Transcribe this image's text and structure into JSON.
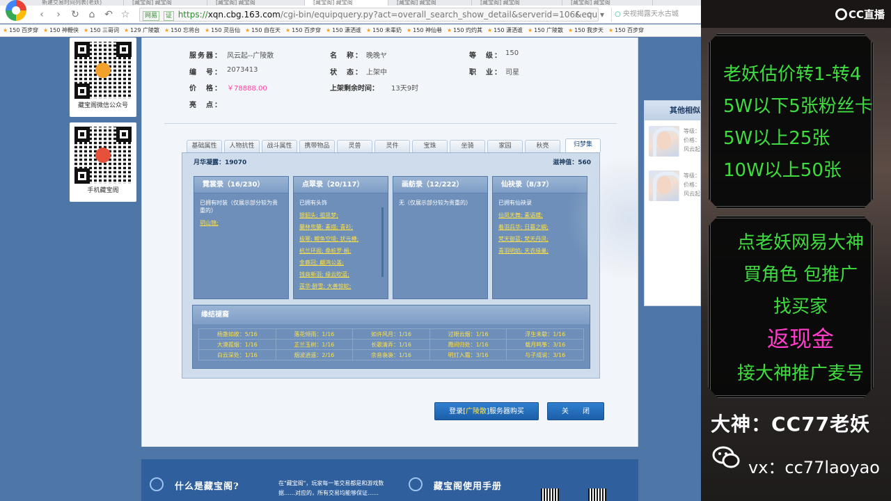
{
  "browser": {
    "tabs": [
      {
        "label": "新建交易时间列表(老妖)"
      },
      {
        "label": "[藏宝阁] 藏宝阁"
      },
      {
        "label": "[藏宝阁] 藏宝阁"
      },
      {
        "label": "[藏宝阁] 藏宝阁"
      },
      {
        "label": "[藏宝阁] 藏宝阁"
      },
      {
        "label": "[藏宝阁] 藏宝阁"
      },
      {
        "label": "[藏宝阁] 藏宝阁"
      }
    ],
    "addr_badge1": "网易",
    "addr_badge2": "证",
    "url_scheme": "https://",
    "url_host": "xqn.cbg.163.com",
    "url_path": "/cgi-bin/equipquery.py?act=overall_search_show_detail&serverid=106&equip_id=",
    "search_placeholder": "央视揭露天水古城",
    "bookmarks": [
      "150 百步穿",
      "150 神鞭侠",
      "150 三哥词",
      "129 广陵散",
      "150 忘将台",
      "150 灵岳仙",
      "150 自在天",
      "150 百步穿",
      "150 潇洒谁",
      "150 未辈奶",
      "150 神仙巷",
      "150 灼灼其",
      "150 潇洒谁",
      "150 广陵散",
      "150 我步天",
      "150 百步穿"
    ]
  },
  "left": {
    "qr1_label": "藏宝阁微信公众号",
    "qr2_label": "手机藏宝阁"
  },
  "info": {
    "server_key": "服务器：",
    "server_val": "风云起--广陵散",
    "name_key": "名　称：",
    "name_val": "晚晚ヤ",
    "level_key": "等　级：",
    "level_val": "150",
    "id_key": "编　号：",
    "id_val": "2073413",
    "status_key": "状　态：",
    "status_val": "上架中",
    "job_key": "职　业：",
    "job_val": "司星",
    "price_key": "价　格：",
    "price_val": "￥78888.00",
    "remain_key": "上架剩余时间：",
    "remain_val": "13天9时",
    "highlight_key": "亮　点："
  },
  "tabs": [
    "基础属性",
    "人物抗性",
    "战斗属性",
    "携带物品",
    "灵兽",
    "灵件",
    "宝珠",
    "坐骑",
    "家园",
    "秋亮",
    "归梦集"
  ],
  "summary": {
    "left": "月华凝露：19070",
    "right": "滋神值：560"
  },
  "cards": [
    {
      "title": "霓裳录（16/230）",
      "desc": "已拥有时装（仅展示部分较为贵重的）",
      "items": [
        "玥山锦;"
      ]
    },
    {
      "title": "点翠录（20/117）",
      "desc": "已拥有头饰",
      "items": [
        "银貂头;  祖思梦;",
        "蘭林兜蘭;  素描;  青衫;",
        "极寒;  鲤鱼空境;  状元樽;",
        "杭兰环阁;  桑桩罗·楫;",
        "金鹿冠;  翩鸿公盖;",
        "钱商新羽;  缘云吹蓝;",
        "莲华·醉雪;  大善惊蛇;"
      ]
    },
    {
      "title": "画舫录（12/222）",
      "desc": "无（仅展示部分较为贵重的）",
      "items": []
    },
    {
      "title": "仙袂录（8/37）",
      "desc": "已拥有仙袂录",
      "items": [
        "仙凤天舞;  素语蝶;",
        "着羽兵华;  日暮之嶼;",
        "梵天御蓝;  梵天丹凤;",
        "青羽明焰;  天衣缘巢;"
      ]
    }
  ],
  "bond": {
    "title": "缘结褪裔",
    "rows": [
      [
        "杨盏如故：5/16",
        "落花倾雨：1/16",
        "如许风月：1/16",
        "过眼云烟：1/16",
        "浮生未歇：1/16"
      ],
      [
        "大漠孤烟：1/16",
        "芷兰玉树：1/16",
        "长歌清弄：1/16",
        "霞间归处：1/16",
        "载月鸣筝：3/16"
      ],
      [
        "白云深处：1/16",
        "烟波逍遥：2/16",
        "余音袅袅：1/16",
        "明灯入霜：3/16",
        "与子成说：3/16"
      ]
    ]
  },
  "buttons": {
    "buy_prefix": "登录[",
    "buy_server": "广陵散",
    "buy_suffix": "]服务器购买",
    "close": "关　　闭"
  },
  "side": {
    "title": "其他相似",
    "items": [
      {
        "l1": "等级：",
        "l2": "价格：",
        "l3": "风云起"
      },
      {
        "l1": "等级：",
        "l2": "价格：",
        "l3": "风云起"
      }
    ]
  },
  "footer": {
    "what_title": "什么是藏宝阁?",
    "what_text": "在\"藏宝阁\"，玩家每一笔交易都是和游戏数据……对应的，所有交易均能够保证……",
    "manual_title": "藏宝阁使用手册"
  },
  "overlay": {
    "cc_logo": "CC直播",
    "lines1": [
      "老妖估价转1-转4",
      "5W以下5张粉丝卡",
      "5W以上25张",
      "10W以上50张"
    ],
    "lines2": [
      "点老妖网易大神",
      "買角色 包推广",
      "找买家",
      "返现金",
      "接大神推广麦号"
    ],
    "bigname": "大神：CC77老妖",
    "vx": "vx：cc77laoyao"
  },
  "colors": {
    "price": "#ff44aa",
    "item_yellow": "#ffe14a",
    "overlay_green": "#3fdc3f",
    "overlay_pink": "#ff3dc8",
    "page_blue": "#4e76a6"
  }
}
